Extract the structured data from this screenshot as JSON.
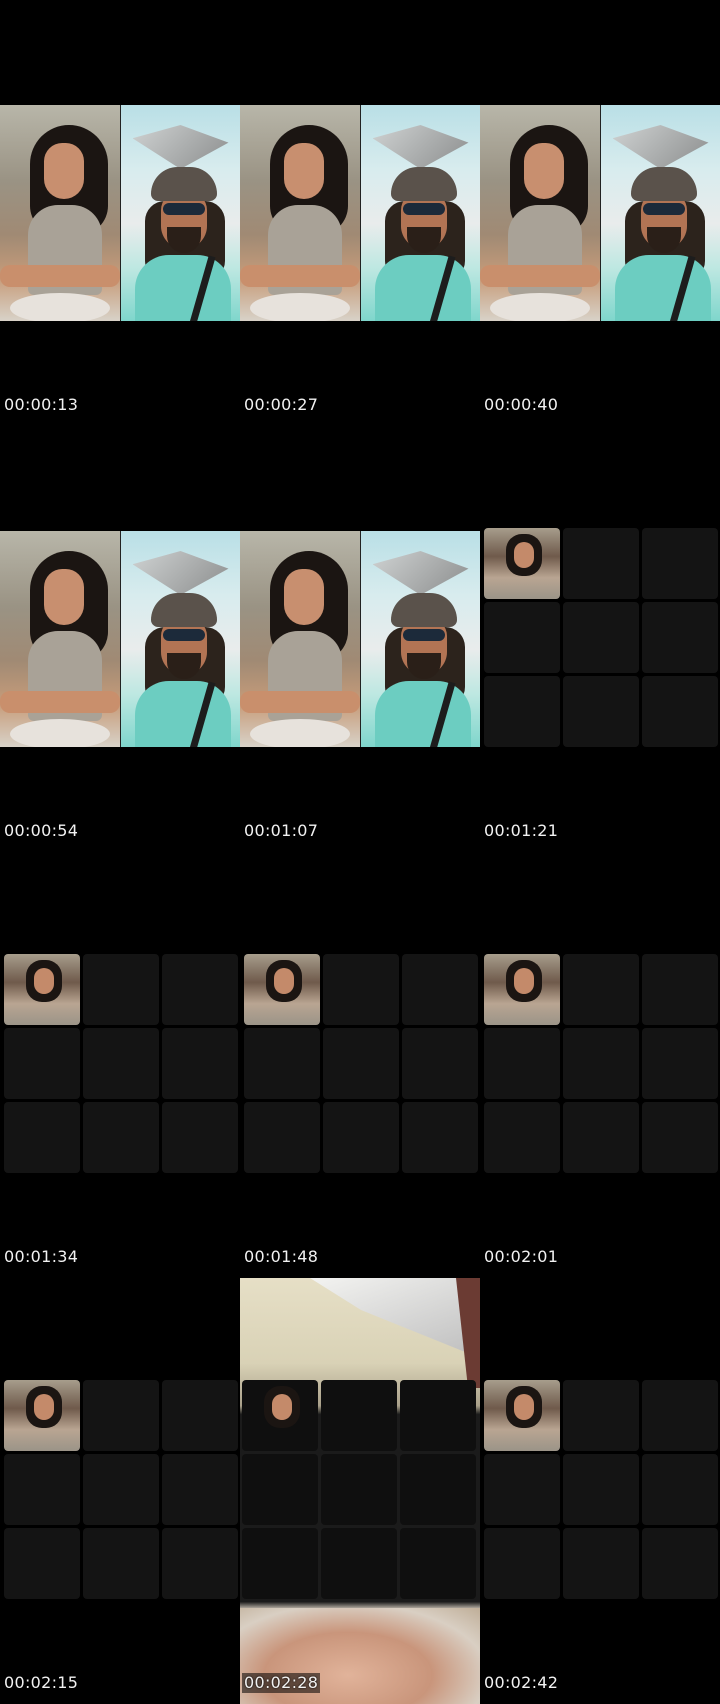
{
  "contact_sheet": {
    "timestamps": [
      "00:00:13",
      "00:00:27",
      "00:00:40",
      "00:00:54",
      "00:01:07",
      "00:01:21",
      "00:01:34",
      "00:01:48",
      "00:02:01",
      "00:02:15",
      "00:02:28",
      "00:02:42"
    ]
  },
  "colors": {
    "background": "#000000",
    "timestamp_text": "#f2f2f2",
    "empty_tile": "#141414"
  }
}
